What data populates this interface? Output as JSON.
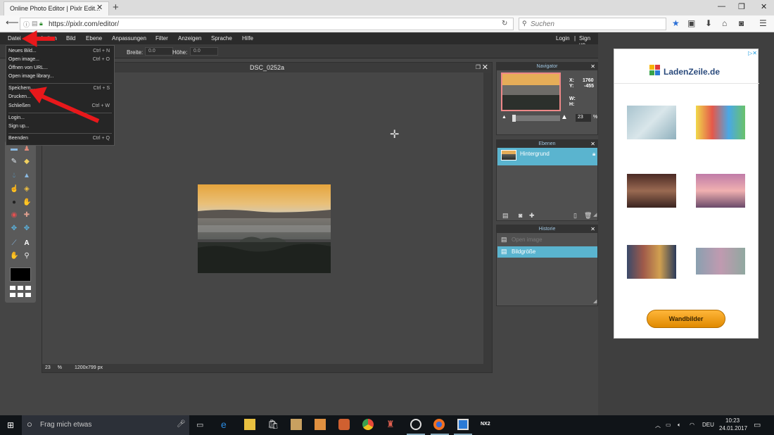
{
  "browser": {
    "tab_title": "Online Photo Editor | Pixlr Edit...",
    "url": "https://pixlr.com/editor/",
    "search_placeholder": "Suchen"
  },
  "menu": {
    "items": [
      "Datei",
      "Bearbeiten",
      "Bild",
      "Ebene",
      "Anpassungen",
      "Filter",
      "Anzeigen",
      "Sprache",
      "Hilfe"
    ],
    "login": "Login",
    "separator": "|",
    "signup": "Sign up"
  },
  "options": {
    "width_label": "Breite:",
    "width_value": "0.0",
    "height_label": "Höhe:",
    "height_value": "0.0"
  },
  "file_menu": {
    "items": [
      {
        "label": "Neues Bild...",
        "shortcut": "Ctrl + N"
      },
      {
        "label": "Open image...",
        "shortcut": "Ctrl + O"
      },
      {
        "label": "Öffnen von URL...",
        "shortcut": ""
      },
      {
        "label": "Open image library...",
        "shortcut": ""
      },
      {
        "label": "Speichern...",
        "shortcut": "Ctrl + S"
      },
      {
        "label": "Drucken...",
        "shortcut": ""
      },
      {
        "label": "Schließen",
        "shortcut": "Ctrl + W"
      },
      {
        "label": "Login...",
        "shortcut": ""
      },
      {
        "label": "Sign up...",
        "shortcut": ""
      },
      {
        "label": "Beenden",
        "shortcut": "Ctrl + Q"
      }
    ]
  },
  "document": {
    "title": "DSC_0252a",
    "zoom": "23",
    "zoom_unit": "%",
    "size": "1200x799 px"
  },
  "navigator": {
    "title": "Navigator",
    "x_label": "X:",
    "x_value": "1760",
    "y_label": "Y:",
    "y_value": "-455",
    "w_label": "W:",
    "h_label": "H:",
    "zoom": "23",
    "zoom_unit": "%"
  },
  "layers": {
    "title": "Ebenen",
    "items": [
      "Hintergrund"
    ]
  },
  "history": {
    "title": "Historie",
    "items": [
      "Open image",
      "Bildgröße"
    ]
  },
  "ad": {
    "brand": "LadenZeile.de",
    "button": "Wandbilder"
  },
  "taskbar": {
    "search": "Frag mich etwas",
    "lang": "DEU",
    "time": "10:23",
    "date": "24.01.2017"
  },
  "colors": {
    "accent_blue": "#5ab4cf",
    "annotation_red": "#e8181b",
    "ad_button": "#f0a020"
  }
}
